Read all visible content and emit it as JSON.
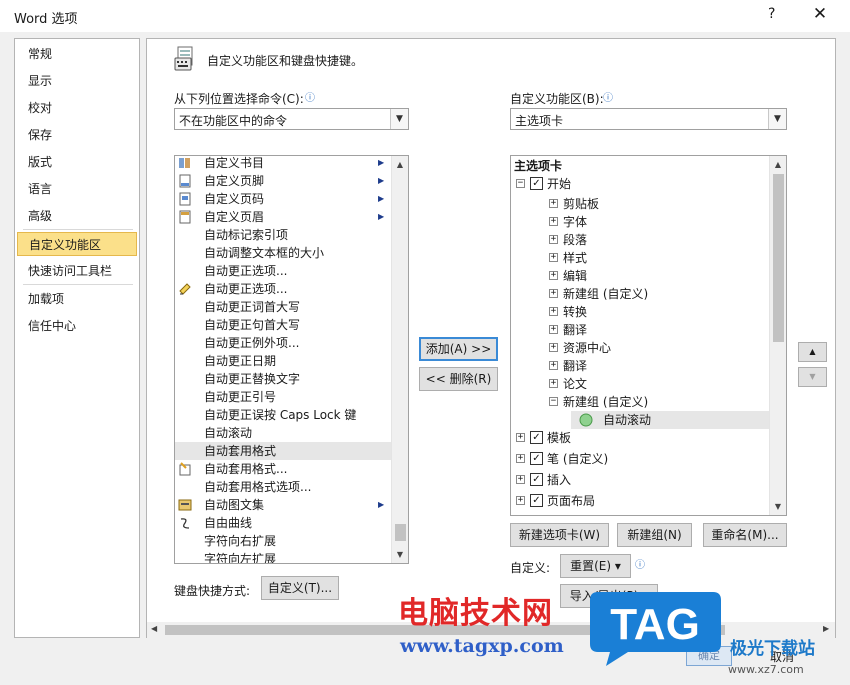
{
  "window": {
    "title": "Word 选项",
    "help": "?",
    "close": "✕"
  },
  "nav": {
    "items": [
      "常规",
      "显示",
      "校对",
      "保存",
      "版式",
      "语言",
      "高级",
      "自定义功能区",
      "快速访问工具栏",
      "加载项",
      "信任中心"
    ],
    "selected_index": 7
  },
  "header": {
    "text": "自定义功能区和键盘快捷键。"
  },
  "left": {
    "label": "从下列位置选择命令(C):",
    "combo_value": "不在功能区中的命令",
    "items": [
      "自定义书目",
      "自定义页脚",
      "自定义页码",
      "自定义页眉",
      "自动标记索引项",
      "自动调整文本框的大小",
      "自动更正选项...",
      "自动更正选项...",
      "自动更正词首大写",
      "自动更正句首大写",
      "自动更正例外项...",
      "自动更正日期",
      "自动更正替换文字",
      "自动更正引号",
      "自动更正误按 Caps Lock 键",
      "自动滚动",
      "自动套用格式",
      "自动套用格式...",
      "自动套用格式选项...",
      "自动图文集",
      "自由曲线",
      "字符向右扩展",
      "字符向左扩展"
    ],
    "selected_index": 16
  },
  "buttons": {
    "add": "添加(A) >>",
    "remove": "<< 删除(R)"
  },
  "right": {
    "label": "自定义功能区(B):",
    "combo_value": "主选项卡",
    "tree_header": "主选项卡",
    "tree": {
      "kaishi": "开始",
      "groups": [
        "剪贴板",
        "字体",
        "段落",
        "样式",
        "编辑",
        "新建组 (自定义)",
        "转换",
        "翻译",
        "资源中心",
        "翻译",
        "论文",
        "新建组 (自定义)"
      ],
      "leaf": "自动滚动",
      "tabs": [
        "模板",
        "笔 (自定义)",
        "插入",
        "页面布局"
      ]
    }
  },
  "right_buttons": {
    "new_tab": "新建选项卡(W)",
    "new_group": "新建组(N)",
    "rename": "重命名(M)..."
  },
  "customize": {
    "label": "自定义:",
    "reset": "重置(E) ▾",
    "import_export": "导入/导出(P) ▾"
  },
  "keyboard": {
    "label": "键盘快捷方式:",
    "button": "自定义(T)..."
  },
  "footer": {
    "ok": "确定",
    "cancel": "取消"
  },
  "watermark": {
    "site": "电脑技术网",
    "url": "www.tagxp.com",
    "logo": "TAG",
    "brand": "极光下载站",
    "brand_url": "www.xz7.com"
  }
}
